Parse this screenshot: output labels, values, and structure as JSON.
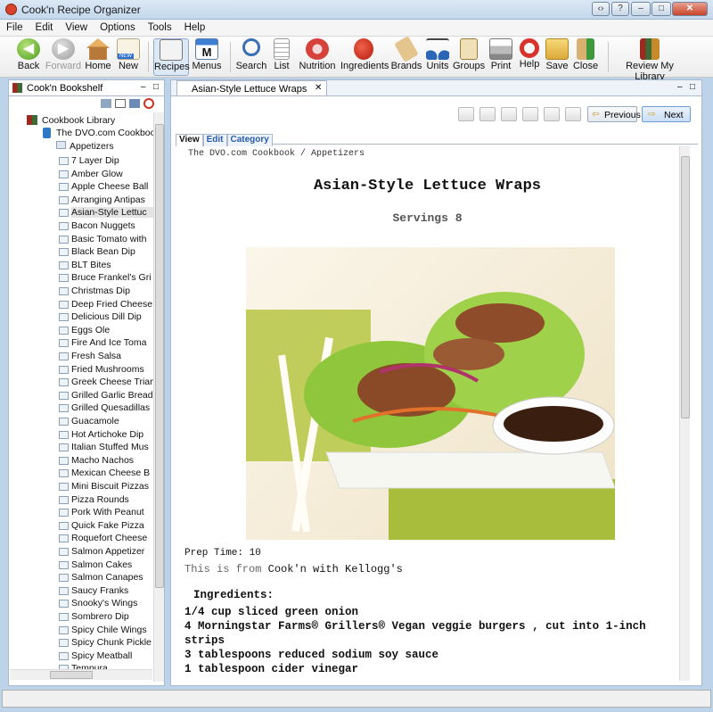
{
  "window": {
    "title": "Cook'n Recipe Organizer"
  },
  "menu": [
    "File",
    "Edit",
    "View",
    "Options",
    "Tools",
    "Help"
  ],
  "toolbar": {
    "back": "Back",
    "forward": "Forward",
    "home": "Home",
    "new": "New",
    "recipes": "Recipes",
    "menus": "Menus",
    "search": "Search",
    "list": "List",
    "nutrition": "Nutrition",
    "ingredients": "Ingredients",
    "brands": "Brands",
    "units": "Units",
    "groups": "Groups",
    "print": "Print",
    "help": "Help",
    "save": "Save",
    "close": "Close",
    "review": "Review My Library",
    "new_badge": "NEW"
  },
  "left": {
    "title": "Cook'n Bookshelf",
    "library": "Cookbook Library",
    "cookbook": "The DVO.com Cookbook",
    "category": "Appetizers",
    "items": [
      "7 Layer Dip",
      "Amber Glow",
      "Apple Cheese Ball",
      "Arranging Antipas",
      "Asian-Style Lettuc",
      "Bacon Nuggets",
      "Basic Tomato with",
      "Black Bean Dip",
      "BLT Bites",
      "Bruce Frankel's Gri",
      "Christmas Dip",
      "Deep Fried Cheese",
      "Delicious Dill Dip",
      "Eggs Ole",
      "Fire And Ice Toma",
      "Fresh Salsa",
      "Fried Mushrooms",
      "Greek Cheese Trian",
      "Grilled Garlic Bread",
      "Grilled Quesadillas",
      "Guacamole",
      "Hot Artichoke Dip",
      "Italian Stuffed Mus",
      "Macho Nachos",
      "Mexican Cheese B",
      "Mini Biscuit Pizzas",
      "Pizza Rounds",
      "Pork With Peanut",
      "Quick Fake Pizza",
      "Roquefort Cheese",
      "Salmon Appetizer",
      "Salmon Cakes",
      "Salmon Canapes",
      "Saucy Franks",
      "Snooky's Wings",
      "Sombrero Dip",
      "Spicy Chile Wings",
      "Spicy Chunk Pickle",
      "Spicy Meatball",
      "Tempura"
    ]
  },
  "right": {
    "tab": "Asian-Style Lettuce Wraps",
    "prev": "Previous",
    "next": "Next",
    "subtabs": [
      "View",
      "Edit",
      "Category"
    ],
    "breadcrumb": "The DVO.com Cookbook / Appetizers",
    "recipe_title": "Asian-Style Lettuce Wraps",
    "servings": "Servings 8",
    "prep_time": "Prep Time: 10",
    "source_prefix": "This is from",
    "source": "Cook'n with Kellogg's",
    "ingredients_heading": "Ingredients:",
    "ingredients": [
      "1/4 cup sliced green onion",
      "4 Morningstar Farms® Grillers® Vegan veggie burgers , cut into 1-inch strips",
      "3 tablespoons reduced sodium soy sauce",
      "1 tablespoon cider vinegar"
    ]
  },
  "colors": {
    "accent": "#2a5da8",
    "frame": "#bcd3ea"
  }
}
